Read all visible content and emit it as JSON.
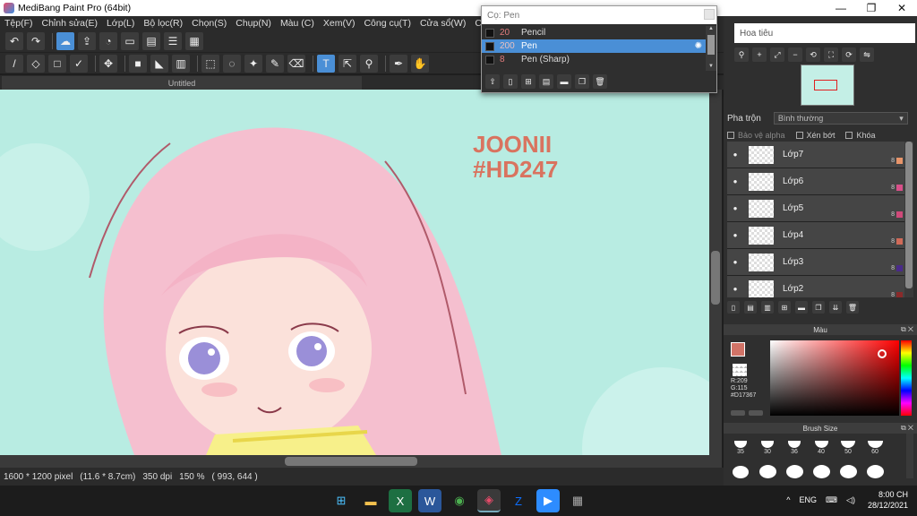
{
  "window": {
    "title": "MediBang Paint Pro (64bit)",
    "minimize": "—",
    "maximize": "❐",
    "close": "✕"
  },
  "menu": [
    "Tệp(F)",
    "Chỉnh sửa(E)",
    "Lớp(L)",
    "Bộ lọc(R)",
    "Chọn(S)",
    "Chụp(N)",
    "Màu (C)",
    "Xem(V)",
    "Công cụ(T)",
    "Cửa sổ(W)",
    "Cloud"
  ],
  "document_tab": "Untitled",
  "artwork": {
    "signature_line1": "JOONII",
    "signature_line2": "#HD247"
  },
  "status": {
    "size": "1600 * 1200 pixel",
    "physical": "(11.6 * 8.7cm)",
    "dpi": "350 dpi",
    "zoom": "150 %",
    "coords": "( 993, 644 )"
  },
  "brush_popup": {
    "title": "Cọ: Pen",
    "items": [
      {
        "size": "20",
        "name": "Pencil",
        "selected": false
      },
      {
        "size": "200",
        "name": "Pen",
        "selected": true
      },
      {
        "size": "8",
        "name": "Pen (Sharp)",
        "selected": false
      }
    ]
  },
  "navigator": {
    "title": "Hoa tiêu"
  },
  "layers_panel": {
    "blend_label": "Pha trộn",
    "blend_value": "Bình thường",
    "protect_alpha": "Bảo vệ alpha",
    "clipping": "Xén bớt",
    "lock": "Khóa",
    "layers": [
      {
        "name": "Lớp7",
        "opacity": "8",
        "color": "#e8956a"
      },
      {
        "name": "Lớp6",
        "opacity": "8",
        "color": "#d9508a"
      },
      {
        "name": "Lớp5",
        "opacity": "8",
        "color": "#d04a7a"
      },
      {
        "name": "Lớp4",
        "opacity": "8",
        "color": "#d06a58"
      },
      {
        "name": "Lớp3",
        "opacity": "8",
        "color": "#4a2a8a"
      },
      {
        "name": "Lớp2",
        "opacity": "8",
        "color": "#8a2a2a"
      }
    ]
  },
  "color_panel": {
    "title": "Màu",
    "r": "R:209",
    "g": "G:115",
    "hex": "#D17367",
    "foreground": "#d17367"
  },
  "brush_size_panel": {
    "title": "Brush Size",
    "sizes": [
      "35",
      "30",
      "36",
      "40",
      "50",
      "60"
    ]
  },
  "taskbar": {
    "lang": "ENG",
    "time": "8:00 CH",
    "date": "28/12/2021"
  }
}
